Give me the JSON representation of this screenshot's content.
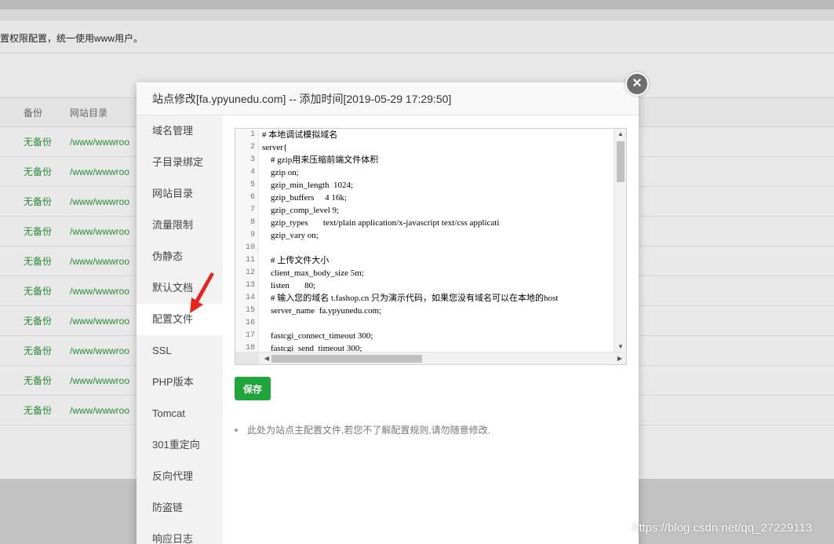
{
  "background": {
    "notice": "置权限配置，统一使用www用户。",
    "table_header": {
      "col_backup": "备份",
      "col_dir": "网站目录"
    },
    "rows": [
      {
        "backup": "无备份",
        "dir": "/www/wwwroo"
      },
      {
        "backup": "无备份",
        "dir": "/www/wwwroo"
      },
      {
        "backup": "无备份",
        "dir": "/www/wwwroo"
      },
      {
        "backup": "无备份",
        "dir": "/www/wwwroo"
      },
      {
        "backup": "无备份",
        "dir": "/www/wwwroo"
      },
      {
        "backup": "无备份",
        "dir": "/www/wwwroo"
      },
      {
        "backup": "无备份",
        "dir": "/www/wwwroo"
      },
      {
        "backup": "无备份",
        "dir": "/www/wwwroo"
      },
      {
        "backup": "无备份",
        "dir": "/www/wwwroo"
      },
      {
        "backup": "无备份",
        "dir": "/www/wwwroo"
      }
    ]
  },
  "dialog": {
    "title": "站点修改[fa.ypyunedu.com] -- 添加时间[2019-05-29 17:29:50]",
    "close_label": "×",
    "menu": [
      "域名管理",
      "子目录绑定",
      "网站目录",
      "流量限制",
      "伪静态",
      "默认文档",
      "配置文件",
      "SSL",
      "PHP版本",
      "Tomcat",
      "301重定向",
      "反向代理",
      "防盗链",
      "响应日志"
    ],
    "active_menu": "配置文件",
    "editor": {
      "line_numbers": [
        "1",
        "2",
        "3",
        "4",
        "5",
        "6",
        "7",
        "8",
        "9",
        "10",
        "11",
        "12",
        "13",
        "14",
        "15",
        "16",
        "17",
        "18"
      ],
      "lines": [
        "# 本地调试模拟域名",
        "server{",
        "    # gzip用来压缩前端文件体积",
        "    gzip on;",
        "    gzip_min_length  1024;",
        "    gzip_buffers     4 16k;",
        "    gzip_comp_level 9;",
        "    gzip_types       text/plain application/x-javascript text/css applicati",
        "    gzip_vary on;",
        "",
        "    # 上传文件大小",
        "    client_max_body_size 5m;",
        "    listen       80;",
        "    # 输入您的域名 t.fashop.cn 只为演示代码，如果您没有域名可以在本地的host",
        "    server_name  fa.ypyunedu.com;",
        "",
        "    fastcgi_connect_timeout 300;",
        "    fastcgi_send_timeout 300;"
      ]
    },
    "save_label": "保存",
    "tip": "此处为站点主配置文件,若您不了解配置规则,请勿随意修改."
  },
  "watermark": "https://blog.csdn.net/qq_27229113",
  "colors": {
    "accent": "#20a53a",
    "status_green": "#2a8a34",
    "annotation_red": "#e8231c"
  }
}
